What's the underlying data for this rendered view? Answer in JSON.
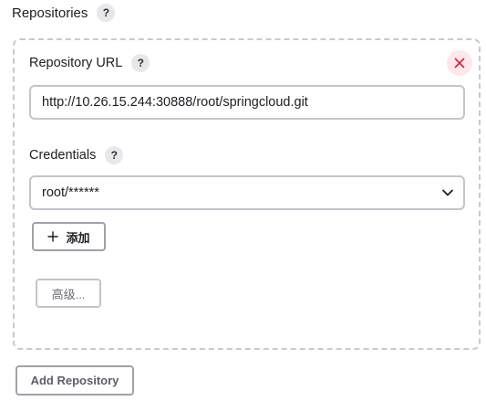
{
  "repositories": {
    "title": "Repositories",
    "help": "?",
    "items": [
      {
        "url_label": "Repository URL",
        "url_help": "?",
        "url_value": "http://10.26.15.244:30888/root/springcloud.git",
        "credentials_label": "Credentials",
        "credentials_help": "?",
        "credentials_value": "root/******",
        "add_label": "添加",
        "advanced_label": "高级..."
      }
    ],
    "add_repository_label": "Add Repository"
  },
  "icons": {
    "close": "close-icon",
    "chevron": "chevron-down-icon",
    "plus": "plus-icon"
  },
  "colors": {
    "close_bg": "#fde7ea",
    "close_fg": "#d11f36",
    "border": "#c1c5cc"
  }
}
